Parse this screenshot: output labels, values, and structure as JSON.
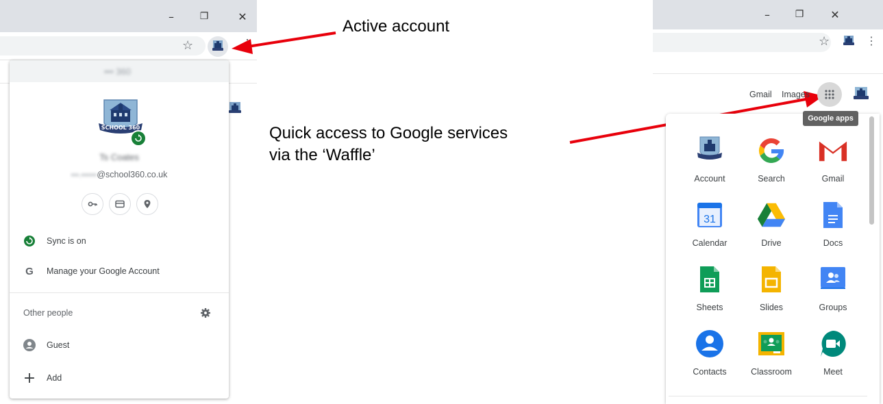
{
  "left_window": {
    "window_controls": {
      "minimize": "–",
      "restore": "❐",
      "close": "✕"
    },
    "star_icon": "☆",
    "more_icon": "⋮"
  },
  "profile_menu": {
    "header_blurred": "••• 360",
    "name_blurred": "Ts Coates",
    "email_blurred": "•••.••••••",
    "email_domain": "@school360.co.uk",
    "shortcuts": [
      "key-icon",
      "card-icon",
      "location-icon"
    ],
    "sync_label": "Sync is on",
    "manage_label": "Manage your Google Account",
    "other_people_label": "Other people",
    "guest_label": "Guest",
    "add_label": "Add",
    "colors": {
      "sync_green": "#188038",
      "menu_bg": "#ffffff"
    }
  },
  "annotations": {
    "active_account": "Active account",
    "quick_access_line1": "Quick access to Google services",
    "quick_access_line2": "via the ‘Waffle’",
    "arrow_color": "#e8000b"
  },
  "right_window": {
    "window_controls": {
      "minimize": "–",
      "restore": "❐",
      "close": "✕"
    },
    "star_icon": "☆",
    "more_icon": "⋮",
    "gmail_link": "Gmail",
    "images_link": "Images",
    "apps_tooltip": "Google apps"
  },
  "apps": [
    {
      "label": "Account",
      "icon": "account-icon"
    },
    {
      "label": "Search",
      "icon": "google-g-icon"
    },
    {
      "label": "Gmail",
      "icon": "gmail-icon"
    },
    {
      "label": "Calendar",
      "icon": "calendar-icon",
      "day": "31"
    },
    {
      "label": "Drive",
      "icon": "drive-icon"
    },
    {
      "label": "Docs",
      "icon": "docs-icon"
    },
    {
      "label": "Sheets",
      "icon": "sheets-icon"
    },
    {
      "label": "Slides",
      "icon": "slides-icon"
    },
    {
      "label": "Groups",
      "icon": "groups-icon"
    },
    {
      "label": "Contacts",
      "icon": "contacts-icon"
    },
    {
      "label": "Classroom",
      "icon": "classroom-icon"
    },
    {
      "label": "Meet",
      "icon": "meet-icon"
    }
  ]
}
